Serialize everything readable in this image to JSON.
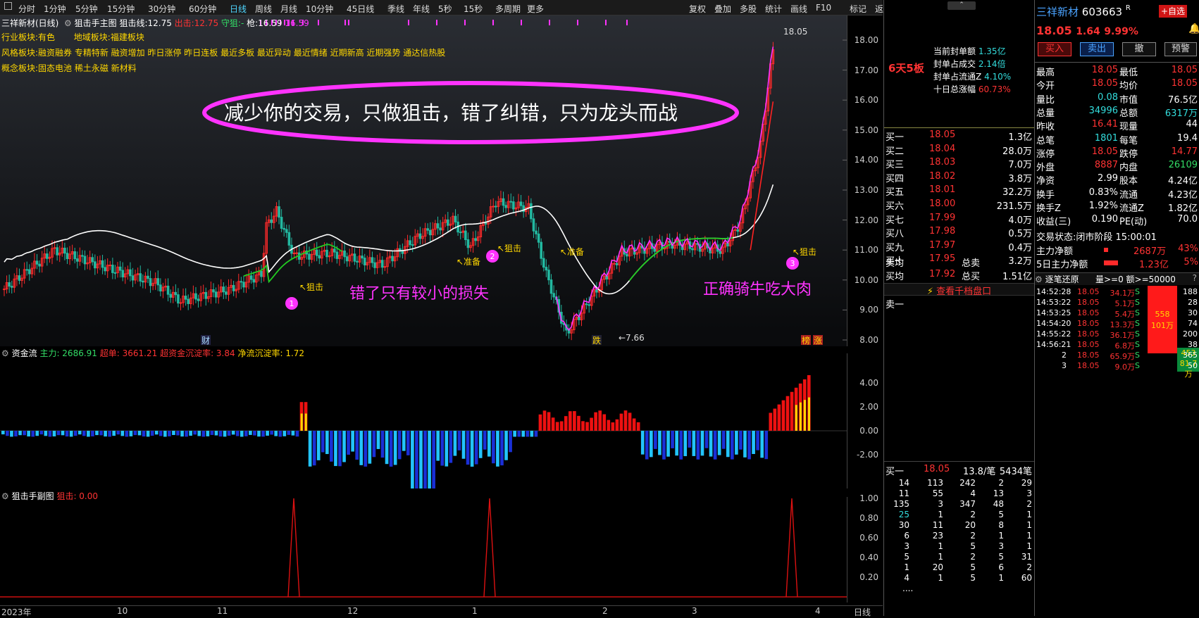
{
  "toolbar": {
    "periods": [
      "分时",
      "1分钟",
      "5分钟",
      "15分钟",
      "30分钟",
      "60分钟",
      "日线",
      "周线",
      "月线",
      "10分钟",
      "45日线",
      "季线",
      "年线",
      "5秒",
      "15秒",
      "多周期",
      "更多"
    ],
    "active": "日线",
    "right": [
      "复权",
      "叠加",
      "多股",
      "统计",
      "画线",
      "F10",
      "标记",
      "返回"
    ]
  },
  "chart": {
    "title": "三祥新材(日线)",
    "indicator": "狙击手主图",
    "snipe_line_label": "狙击线:",
    "snipe_line_val": "12.75",
    "exit_label": "出击:",
    "exit_val": "12.75",
    "guard_label": "守狙:",
    "guard_val": "-",
    "gun_label": "枪:",
    "gun_val": "16.59",
    "purple_val": "16.59",
    "industry_label": "行业板块:",
    "industry": "有色",
    "region_label": "地域板块:",
    "region": "福建板块",
    "style_label": "风格板块:",
    "style": "融资融券 专精特新 融资增加 昨日涨停 昨日连板 最近多板 最近异动 最近情绪 近期新高 近期强势 通达信热股",
    "concept_label": "概念板块:",
    "concept": "固态电池 稀土永磁 新材料",
    "slogan": "减少你的交易，只做狙击，错了纠错，只为龙头而战",
    "note_left": "错了只有较小的损失",
    "note_right": "正确骑牛吃大肉",
    "high_marker": "18.05",
    "low_marker": "←7.66",
    "signals": [
      {
        "text": "↖狙击"
      },
      {
        "text": "↖准备"
      },
      {
        "text": "↖狙击"
      },
      {
        "text": "↖准备"
      },
      {
        "text": "↖狙击"
      }
    ],
    "circles": [
      "1",
      "2",
      "3"
    ],
    "bottom_tags": {
      "cai": "财",
      "die": "跌",
      "bang": "榜",
      "zhang": "涨"
    },
    "yticks": [
      "18.00",
      "17.00",
      "16.00",
      "15.00",
      "14.00",
      "13.00",
      "12.00",
      "11.00",
      "10.00",
      "9.00",
      "8.00"
    ],
    "fund_label": "资金流",
    "fund_main": "主力: 2686.91",
    "fund_super": "超单: 3661.21",
    "fund_super_rate": "超资金沉淀率: 3.84",
    "fund_net": "净流沉淀率: 1.72",
    "fund_yticks": [
      "4.00",
      "2.00",
      "0.00",
      "-2.00"
    ],
    "sub_label": "狙击手副图",
    "sub_val": "狙击: 0.00",
    "sub_yticks": [
      "1.00",
      "0.80",
      "0.60",
      "0.40",
      "0.20"
    ],
    "xticks": [
      "2023年",
      "10",
      "11",
      "12",
      "1",
      "2",
      "3",
      "4"
    ],
    "x_period": "日线"
  },
  "mid": {
    "board_tag": "6天5板",
    "seal": [
      {
        "k": "当前封单额",
        "v": "1.35亿"
      },
      {
        "k": "封单占成交",
        "v": "2.14倍"
      },
      {
        "k": "封单占流通Z",
        "v": "4.10%"
      },
      {
        "k": "十日总涨幅",
        "v": "60.73%"
      }
    ],
    "bids": [
      [
        "买一",
        "18.05",
        "1.3亿"
      ],
      [
        "买二",
        "18.04",
        "28.0万"
      ],
      [
        "买三",
        "18.03",
        "7.0万"
      ],
      [
        "买四",
        "18.02",
        "3.8万"
      ],
      [
        "买五",
        "18.01",
        "32.2万"
      ],
      [
        "买六",
        "18.00",
        "231.5万"
      ],
      [
        "买七",
        "17.99",
        "4.0万"
      ],
      [
        "买八",
        "17.98",
        "0.5万"
      ],
      [
        "买九",
        "17.97",
        "0.4万"
      ],
      [
        "买十",
        "17.95",
        "3.2万"
      ]
    ],
    "avg": [
      [
        "卖均",
        "",
        "总卖",
        ""
      ],
      [
        "买均",
        "17.92",
        "总买",
        "1.51亿"
      ]
    ],
    "link": "查看千档盘口",
    "sell1": "卖一",
    "q_head": [
      "买一",
      "18.05",
      "13.8/笔",
      "5434笔"
    ],
    "q_rows": [
      [
        "14",
        "113",
        "242",
        "2",
        "29"
      ],
      [
        "11",
        "55",
        "4",
        "13",
        "3"
      ],
      [
        "135",
        "3",
        "347",
        "48",
        "2"
      ],
      [
        "25",
        "1",
        "2",
        "5",
        "1"
      ],
      [
        "30",
        "11",
        "20",
        "8",
        "1"
      ],
      [
        "6",
        "23",
        "2",
        "1",
        "1"
      ],
      [
        "3",
        "1",
        "5",
        "3",
        "1"
      ],
      [
        "5",
        "1",
        "2",
        "5",
        "31"
      ],
      [
        "1",
        "20",
        "5",
        "6",
        "2"
      ],
      [
        "4",
        "1",
        "5",
        "1",
        "60"
      ]
    ],
    "q_more": "...."
  },
  "quote": {
    "name": "三祥新材",
    "code": "603663",
    "flag": "R",
    "add_btn": "+自选",
    "price": "18.05",
    "chg": "1.64",
    "pct": "9.99%",
    "buttons": [
      "买入",
      "卖出",
      "撤",
      "预警"
    ],
    "stats": [
      [
        "最高",
        "18.05",
        "最低",
        "18.05"
      ],
      [
        "今开",
        "18.05",
        "均价",
        "18.05"
      ],
      [
        "量比",
        "0.08",
        "市值",
        "76.5亿"
      ],
      [
        "总量",
        "34996",
        "总额",
        "6317万"
      ],
      [
        "昨收",
        "16.41",
        "现量",
        "44"
      ],
      [
        "总笔",
        "1801",
        "每笔",
        "19.4"
      ],
      [
        "涨停",
        "18.05",
        "跌停",
        "14.77"
      ],
      [
        "外盘",
        "8887",
        "内盘",
        "26109"
      ],
      [
        "净资",
        "2.99",
        "股本",
        "4.24亿"
      ],
      [
        "换手",
        "0.83%",
        "流通",
        "4.23亿"
      ],
      [
        "换手Z",
        "1.92%",
        "流通Z",
        "1.82亿"
      ],
      [
        "收益(三)",
        "0.190",
        "PE(动)",
        "70.0"
      ]
    ],
    "status_label": "交易状态:",
    "status": "闭市阶段 15:00:01",
    "main_net_label": "主力净额",
    "main_net": "2687万",
    "main_net_pct": "43%",
    "net5_label": "5日主力净额",
    "net5": "1.23亿",
    "net5_pct": "5%",
    "tick_title": "逐笔还原",
    "tick_filter": "量>=0 额>=50000",
    "ticks": [
      [
        "14:52:28",
        "18.05",
        "34.1万",
        "S",
        "188"
      ],
      [
        "14:53:22",
        "18.05",
        "5.1万",
        "S",
        "28"
      ],
      [
        "14:53:25",
        "18.05",
        "5.4万",
        "S",
        "30"
      ],
      [
        "14:54:20",
        "18.05",
        "13.3万",
        "S",
        "74"
      ],
      [
        "14:55:22",
        "18.05",
        "36.1万",
        "S",
        "200"
      ],
      [
        "14:56:21",
        "18.05",
        "6.8万",
        "S",
        "38"
      ],
      [
        "2",
        "18.05",
        "65.9万",
        "S",
        "365"
      ],
      [
        "3",
        "18.05",
        "9.0万",
        "S",
        "50"
      ]
    ],
    "bar_a": "558",
    "bar_b": "101万",
    "bar_c": "453",
    "bar_d": "81.7万"
  },
  "colors": {
    "up": "#ff2a2a",
    "down": "#22b8a0",
    "ma": "#ffffff",
    "mag": "#ff33ff"
  }
}
